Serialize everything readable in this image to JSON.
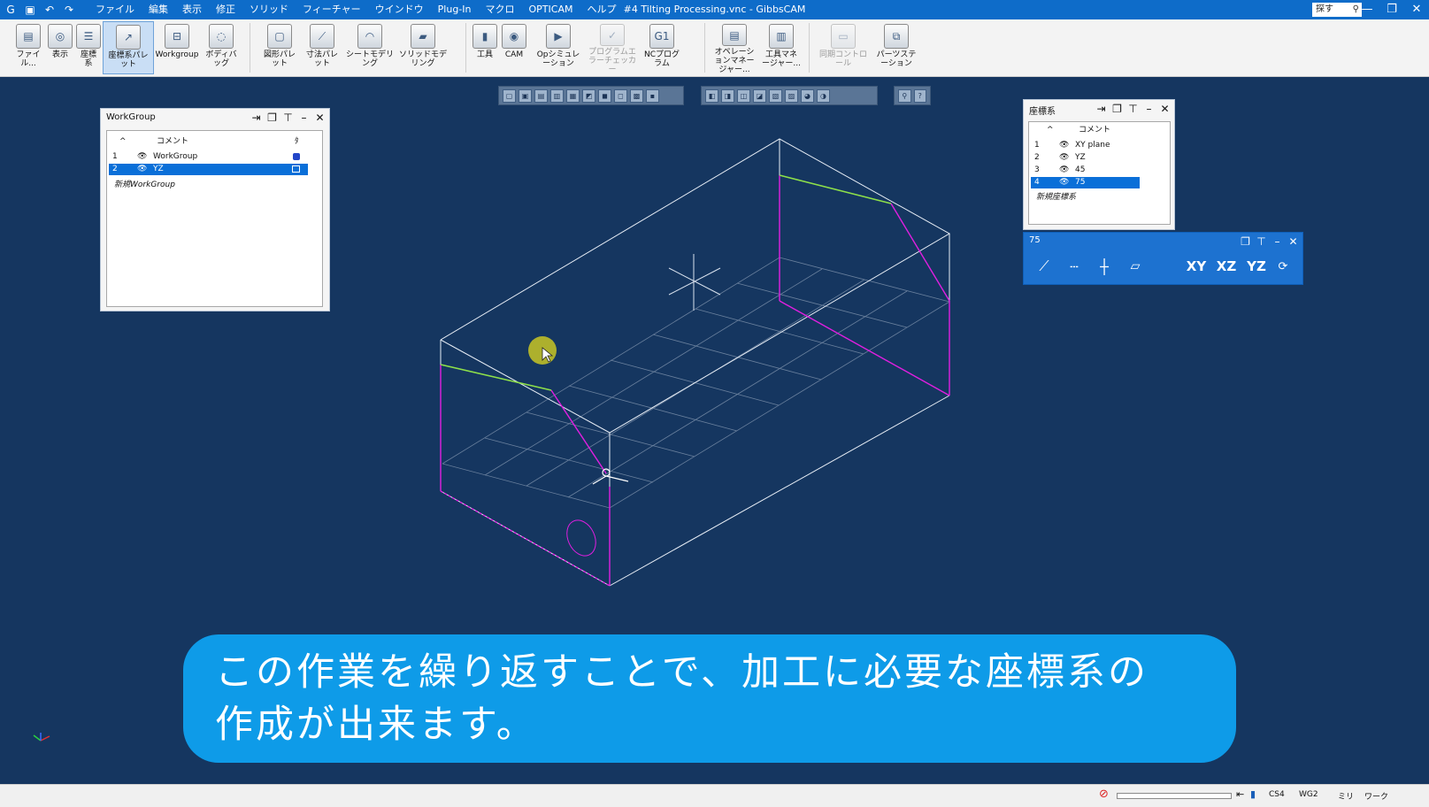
{
  "window": {
    "title": "#4 Tilting Processing.vnc - GibbsCAM",
    "search_placeholder": "探す",
    "controls": [
      "—",
      "❐",
      "✕"
    ]
  },
  "quick_access": [
    "⟲",
    "↶",
    "↷"
  ],
  "menu": [
    "ファイル",
    "編集",
    "表示",
    "修正",
    "ソリッド",
    "フィーチャー",
    "ウインドウ",
    "Plug-In",
    "マクロ",
    "OPTICAM",
    "ヘルプ"
  ],
  "ribbon": {
    "group1": [
      {
        "label": "ファイル...",
        "icon": "file-icon",
        "glyph": "▤"
      },
      {
        "label": "表示",
        "icon": "view-icon",
        "glyph": "◎"
      },
      {
        "label": "座標系",
        "icon": "coordinate-system-icon",
        "glyph": "☰"
      },
      {
        "label": "座標系パレット",
        "icon": "coordinate-palette-icon",
        "glyph": "↗"
      },
      {
        "label": "Workgroup",
        "icon": "workgroup-icon",
        "glyph": "⊟"
      },
      {
        "label": "ボディバッグ",
        "icon": "bodybag-icon",
        "glyph": "◌"
      }
    ],
    "group2": [
      {
        "label": "図形パレット",
        "icon": "geometry-palette-icon",
        "glyph": "▢"
      },
      {
        "label": "寸法パレット",
        "icon": "dimension-palette-icon",
        "glyph": "⟋"
      },
      {
        "label": "シートモデリング",
        "icon": "sheet-modeling-icon",
        "glyph": "◠"
      },
      {
        "label": "ソリッドモデリング",
        "icon": "solid-modeling-icon",
        "glyph": "▰"
      }
    ],
    "group3": [
      {
        "label": "工具",
        "icon": "tool-icon",
        "glyph": "▮"
      },
      {
        "label": "CAM",
        "icon": "cam-icon",
        "glyph": "◉"
      },
      {
        "label": "Opシミュレーション",
        "icon": "op-simulation-icon",
        "glyph": "▶"
      },
      {
        "label": "プログラムエラーチェッカー",
        "icon": "error-checker-icon",
        "glyph": "✓"
      },
      {
        "label": "NCプログラム",
        "icon": "nc-program-icon",
        "glyph": "G1"
      }
    ],
    "group4": [
      {
        "label": "オペレーションマネージャー...",
        "icon": "operation-manager-icon",
        "glyph": "▤"
      },
      {
        "label": "工具マネージャー...",
        "icon": "tool-manager-icon",
        "glyph": "▥"
      }
    ],
    "group5": [
      {
        "label": "同期コントロール",
        "icon": "sync-control-icon",
        "glyph": "▭"
      },
      {
        "label": "パーツステーション",
        "icon": "parts-station-icon",
        "glyph": "⧉"
      }
    ]
  },
  "workgroup": {
    "title": "WorkGroup",
    "col_comment": "コメント",
    "col_extra": "ﾀ",
    "rows": [
      {
        "num": "1",
        "name": "WorkGroup"
      },
      {
        "num": "2",
        "name": "YZ"
      }
    ],
    "new_label": "新規WorkGroup"
  },
  "coords": {
    "title": "座標系",
    "col_comment": "コメント",
    "rows": [
      {
        "num": "1",
        "name": "XY plane"
      },
      {
        "num": "2",
        "name": "YZ"
      },
      {
        "num": "3",
        "name": "45"
      },
      {
        "num": "4",
        "name": "75"
      }
    ],
    "new_label": "新規座標系"
  },
  "subpalette": {
    "title": "75",
    "buttons": [
      "XY",
      "XZ",
      "YZ"
    ]
  },
  "caption": {
    "line1": "この作業を繰り返すことで、加工に必要な座標系の",
    "line2": "作成が出来ます。"
  },
  "status": {
    "cs": "CS4",
    "wg": "WG2",
    "unit": "ミリ",
    "mode": "ワーク"
  }
}
